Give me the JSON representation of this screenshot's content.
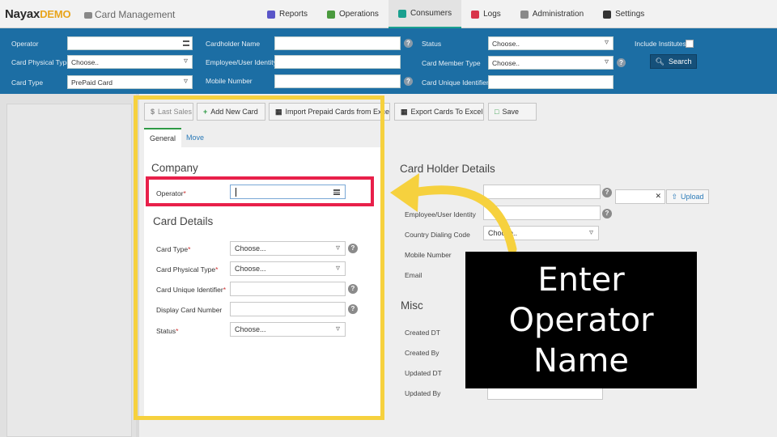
{
  "app": {
    "logo_main": "Nayax",
    "logo_sub": "DEMO",
    "title": "Card Management"
  },
  "nav": {
    "items": [
      {
        "label": "Reports",
        "icon": "reports-icon",
        "color": "#5a56c8"
      },
      {
        "label": "Operations",
        "icon": "operations-icon",
        "color": "#4a9a3e"
      },
      {
        "label": "Consumers",
        "icon": "consumers-icon",
        "color": "#1aa08f"
      },
      {
        "label": "Logs",
        "icon": "logs-icon",
        "color": "#d8344a"
      },
      {
        "label": "Administration",
        "icon": "administration-icon",
        "color": "#8a8a8a"
      },
      {
        "label": "Settings",
        "icon": "settings-icon",
        "color": "#333333"
      }
    ],
    "active": "Consumers"
  },
  "filters": {
    "operator_label": "Operator",
    "operator_value": "",
    "card_physical_type_label": "Card Physical Type",
    "card_physical_type_value": "Choose..",
    "card_type_label": "Card Type",
    "card_type_value": "PrePaid Card",
    "cardholder_name_label": "Cardholder Name",
    "employee_identity_label": "Employee/User Identity",
    "mobile_number_label": "Mobile Number",
    "status_label": "Status",
    "status_value": "Choose..",
    "card_member_type_label": "Card Member Type",
    "card_member_type_value": "Choose..",
    "card_unique_identifier_label": "Card Unique Identifier",
    "include_institutes_label": "Include Institutes",
    "search_label": "Search"
  },
  "toolbar": {
    "last_sales": "Last Sales",
    "add_new_card": "Add New Card",
    "import_prepaid": "Import Prepaid Cards from Exce",
    "export_cards": "Export Cards To Excel",
    "save": "Save"
  },
  "tabs": {
    "general": "General",
    "move": "Move"
  },
  "form": {
    "company_title": "Company",
    "operator_label": "Operator",
    "operator_value": "",
    "card_details_title": "Card Details",
    "card_type_label": "Card Type",
    "card_type_value": "Choose...",
    "card_physical_type_label": "Card Physical Type",
    "card_physical_type_value": "Choose...",
    "card_unique_identifier_label": "Card Unique Identifier",
    "display_card_number_label": "Display Card Number",
    "status_label": "Status",
    "status_value": "Choose..."
  },
  "cardholder": {
    "title": "Card Holder Details",
    "employee_label": "Employee/User Identity",
    "country_dialing_label": "Country Dialing Code",
    "country_dialing_value": "Choose..",
    "mobile_label": "Mobile Number",
    "email_label": "Email",
    "upload_label": "Upload"
  },
  "misc": {
    "title": "Misc",
    "created_dt": "Created DT",
    "created_by": "Created By",
    "updated_dt": "Updated DT",
    "updated_by": "Updated By"
  },
  "callout": {
    "line1": "Enter",
    "line2": "Operator",
    "line3": "Name"
  },
  "colors": {
    "filter_bar": "#1c6ea4",
    "highlight_frame": "#f6d13e",
    "focus_frame": "#e8204a",
    "callout_bg": "#000000"
  }
}
